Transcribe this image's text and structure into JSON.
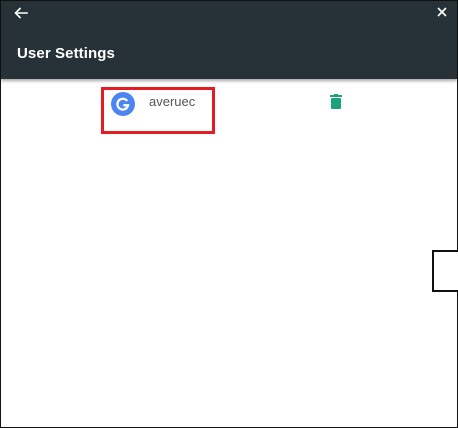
{
  "header": {
    "title": "User Settings",
    "background_color": "#263238",
    "back_icon": "arrow-left-icon",
    "close_icon": "close-icon"
  },
  "accounts": [
    {
      "provider_icon": "google-icon",
      "username": "averuec",
      "delete_icon": "trash-icon",
      "delete_color": "#1aa37a"
    }
  ],
  "highlight_color": "#e51c23"
}
